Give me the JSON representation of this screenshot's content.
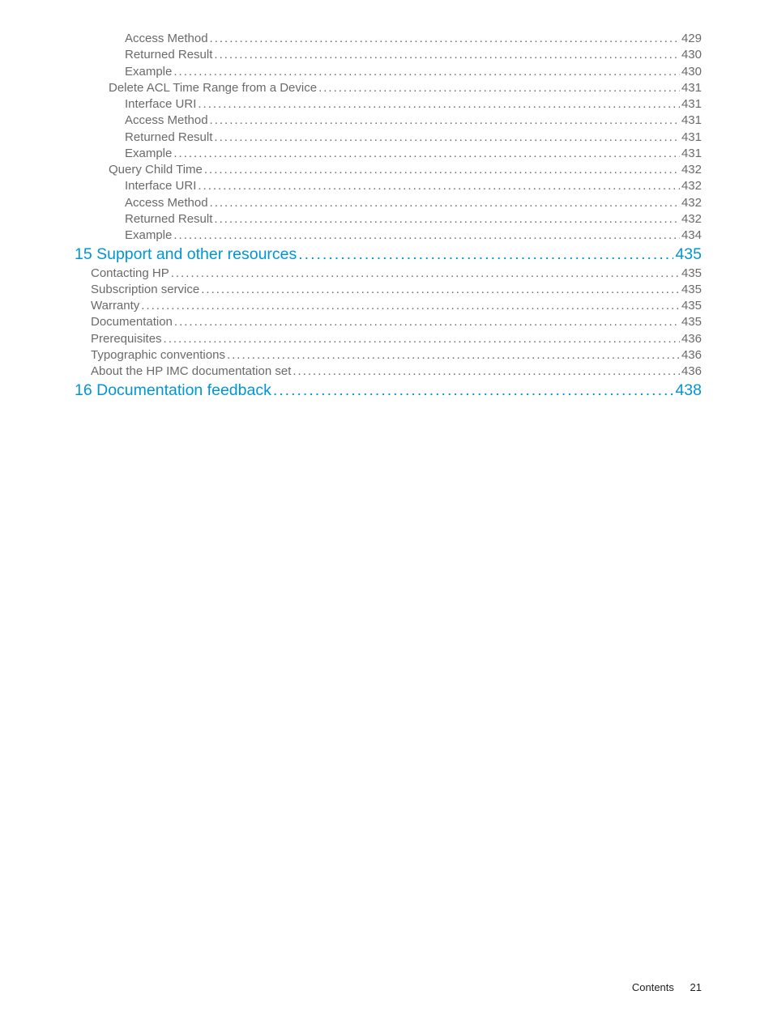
{
  "toc": [
    {
      "level": 3,
      "kind": "body",
      "title": "Access Method",
      "page": "429"
    },
    {
      "level": 3,
      "kind": "body",
      "title": "Returned Result",
      "page": "430"
    },
    {
      "level": 3,
      "kind": "body",
      "title": "Example",
      "page": "430"
    },
    {
      "level": 2,
      "kind": "body",
      "title": "Delete ACL Time Range from a Device",
      "page": "431"
    },
    {
      "level": 3,
      "kind": "body",
      "title": "Interface URI",
      "page": "431"
    },
    {
      "level": 3,
      "kind": "body",
      "title": "Access Method",
      "page": "431"
    },
    {
      "level": 3,
      "kind": "body",
      "title": "Returned Result",
      "page": "431"
    },
    {
      "level": 3,
      "kind": "body",
      "title": "Example",
      "page": "431"
    },
    {
      "level": 2,
      "kind": "body",
      "title": "Query Child Time",
      "page": "432"
    },
    {
      "level": 3,
      "kind": "body",
      "title": "Interface URI",
      "page": "432"
    },
    {
      "level": 3,
      "kind": "body",
      "title": "Access Method",
      "page": "432"
    },
    {
      "level": 3,
      "kind": "body",
      "title": "Returned Result",
      "page": "432"
    },
    {
      "level": 3,
      "kind": "body",
      "title": "Example",
      "page": "434"
    },
    {
      "level": 0,
      "kind": "chapter",
      "title": "15 Support and other resources",
      "page": "435"
    },
    {
      "level": 1,
      "kind": "body",
      "title": "Contacting HP",
      "page": "435"
    },
    {
      "level": 1,
      "kind": "body",
      "title": "Subscription service",
      "page": "435"
    },
    {
      "level": 1,
      "kind": "body",
      "title": "Warranty",
      "page": "435"
    },
    {
      "level": 1,
      "kind": "body",
      "title": "Documentation",
      "page": "435"
    },
    {
      "level": 1,
      "kind": "body",
      "title": "Prerequisites",
      "page": "436"
    },
    {
      "level": 1,
      "kind": "body",
      "title": "Typographic conventions",
      "page": "436"
    },
    {
      "level": 1,
      "kind": "body",
      "title": "About the HP IMC documentation set",
      "page": "436"
    },
    {
      "level": 0,
      "kind": "chapter",
      "title": "16 Documentation feedback",
      "page": "438"
    }
  ],
  "footer": {
    "label": "Contents",
    "page": "21"
  }
}
